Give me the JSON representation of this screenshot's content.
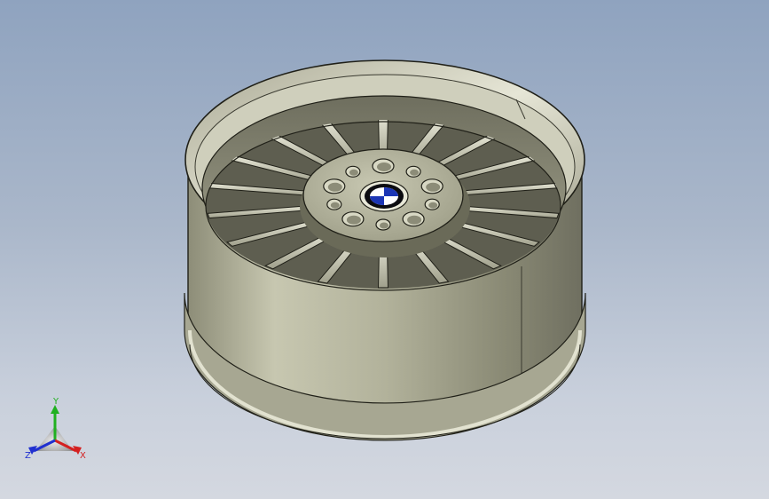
{
  "view": {
    "background_top": "#8fa3bf",
    "background_bottom": "#d4d8e0",
    "model_color": "#b9b9a2"
  },
  "model": {
    "part": "wheel-rim",
    "spoke_count": 18,
    "lug_hole_count": 10,
    "center_cap_icon": "roundel-logo-icon"
  },
  "triad": {
    "x_label": "X",
    "y_label": "Y",
    "z_label": "Z",
    "x_color": "#d42020",
    "y_color": "#20b020",
    "z_color": "#2030d0"
  }
}
